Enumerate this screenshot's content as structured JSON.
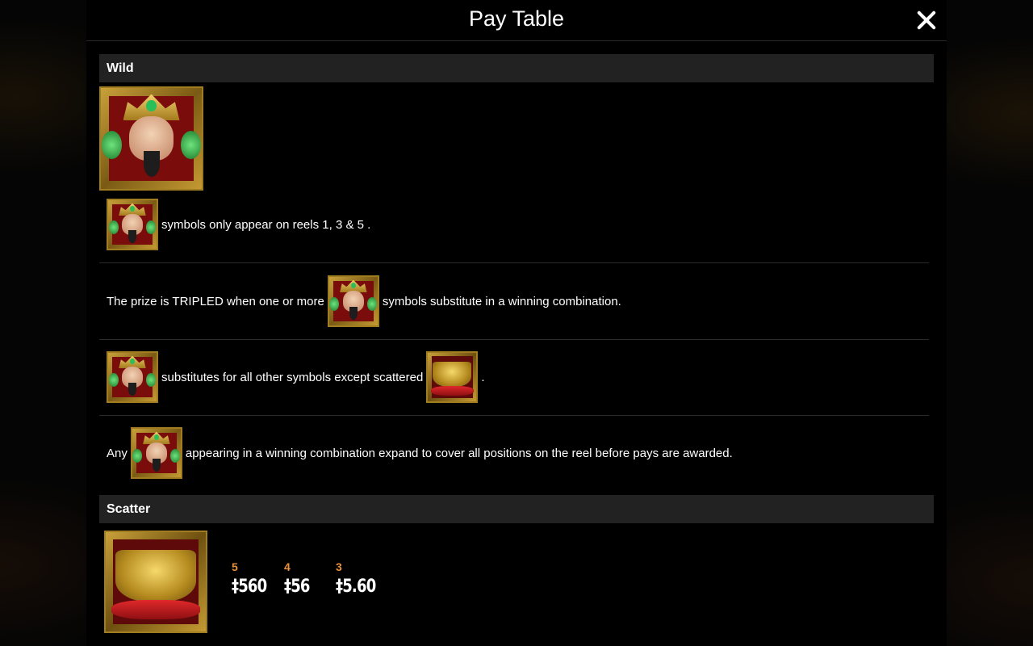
{
  "header": {
    "title": "Pay Table"
  },
  "wild": {
    "section_label": "Wild",
    "rows": [
      {
        "text": "symbols only appear on reels 1, 3 & 5 ."
      },
      {
        "text_before": "The prize is TRIPLED when one or more",
        "text_after": "symbols substitute in a winning combination."
      },
      {
        "text_before": "substitutes for all other symbols except scattered",
        "text_after": "."
      },
      {
        "text_before": "Any",
        "text_after": "appearing in a winning combination expand to cover all positions on the reel before pays are awarded."
      }
    ]
  },
  "scatter": {
    "section_label": "Scatter",
    "pays": [
      {
        "count": "5",
        "amount": "‡560"
      },
      {
        "count": "4",
        "amount": "‡56"
      },
      {
        "count": "3",
        "amount": "‡5.60"
      }
    ]
  },
  "icons": {
    "wild": "wild-face-icon",
    "scatter": "gold-ingot-scatter-icon",
    "close": "close-icon"
  }
}
